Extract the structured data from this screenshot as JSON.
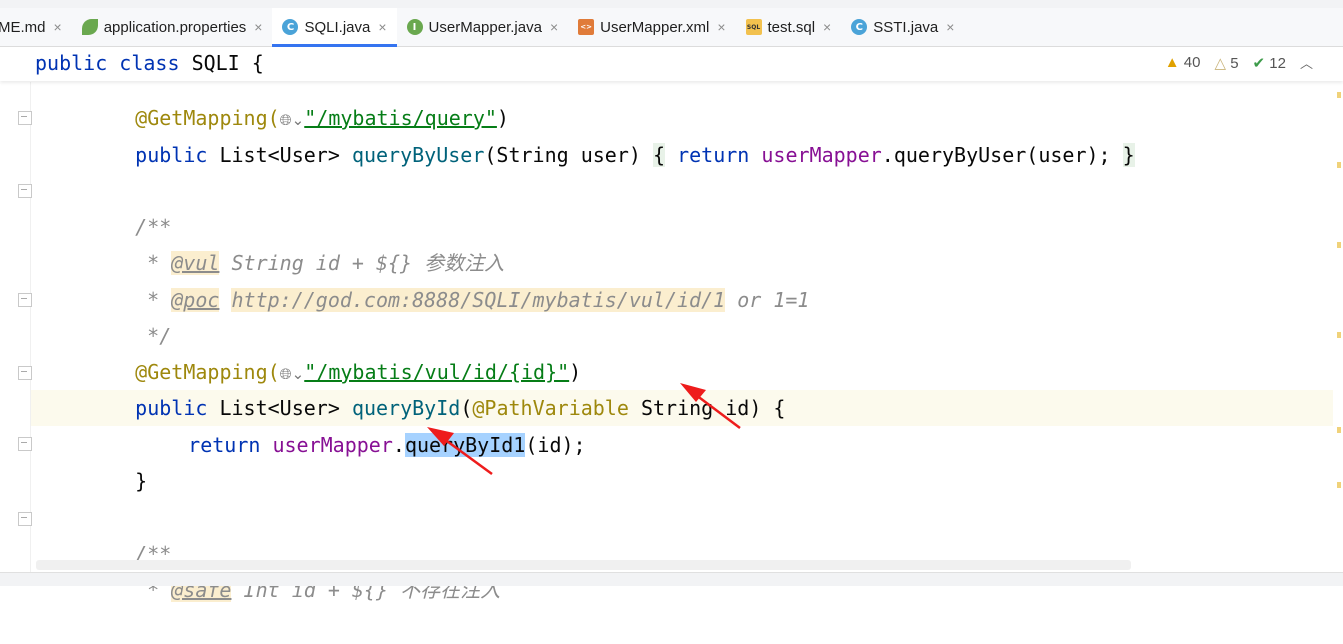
{
  "tabs": [
    {
      "label": "ME.md",
      "icon": "markdown-icon"
    },
    {
      "label": "application.properties",
      "icon": "spring-leaf-icon"
    },
    {
      "label": "SQLI.java",
      "icon": "class-icon",
      "active": true
    },
    {
      "label": "UserMapper.java",
      "icon": "interface-icon"
    },
    {
      "label": "UserMapper.xml",
      "icon": "xml-icon"
    },
    {
      "label": "test.sql",
      "icon": "sql-icon"
    },
    {
      "label": "SSTI.java",
      "icon": "class-icon"
    }
  ],
  "icons": {
    "class": "C",
    "interface": "I",
    "xml": "<>",
    "sql": "SQL",
    "close": "×"
  },
  "sticky": {
    "kw1": "public",
    "kw2": "class",
    "name": "SQLI",
    "brace": "{"
  },
  "inspections": {
    "warnings": "40",
    "weak_warnings": "5",
    "typos": "12"
  },
  "code": {
    "l1": {
      "ann": "@GetMapping(",
      "str": "\"/mybatis/query\"",
      "close": ")"
    },
    "l2": {
      "kw": "public",
      "type": "List<User>",
      "fn": "queryByUser",
      "params": "(String user)",
      "body_kw": "return",
      "field": "userMapper",
      "call": ".queryByUser(user);",
      "open": "{",
      "close": "}"
    },
    "l3": {
      "text": "/**"
    },
    "l4": {
      "star": "*",
      "tag": "@vul",
      "text": "String id + ${} 参数注入"
    },
    "l5": {
      "star": "*",
      "tag": "@poc",
      "url": "http://god.com:8888/SQLI/mybatis/vul/id/1",
      "text": "or 1=1"
    },
    "l6": {
      "text": "*/"
    },
    "l7": {
      "ann": "@GetMapping(",
      "str": "\"/mybatis/vul/id/{id}\"",
      "close": ")"
    },
    "l8": {
      "kw": "public",
      "type": "List<User>",
      "fn": "queryById",
      "open": "(",
      "ann": "@PathVariable",
      "params": "String id) {"
    },
    "l9": {
      "kw": "return",
      "field": "userMapper",
      "dot": ".",
      "sel": "queryById1",
      "rest": "(id);"
    },
    "l10": {
      "text": "}"
    },
    "l11": {
      "text": "/**"
    },
    "l12": {
      "star": "*",
      "tag": "@safe",
      "text": "Int id + ${} 不存在注入"
    }
  }
}
